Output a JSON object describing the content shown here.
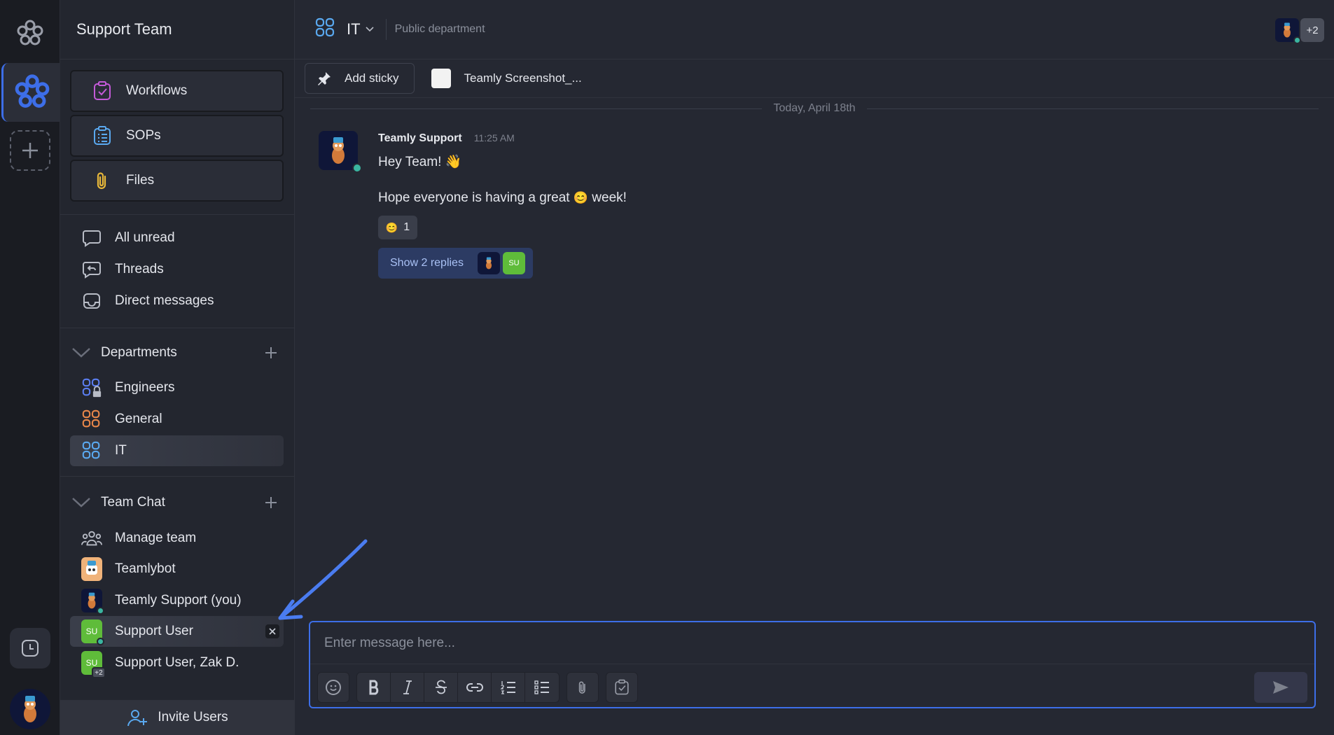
{
  "workspace": {
    "name": "Support Team"
  },
  "sidebar": {
    "primary": [
      {
        "label": "Workflows",
        "icon": "workflows-icon"
      },
      {
        "label": "SOPs",
        "icon": "sops-icon"
      },
      {
        "label": "Files",
        "icon": "files-icon"
      }
    ],
    "nav": [
      {
        "label": "All unread",
        "icon": "chat-bubble-icon"
      },
      {
        "label": "Threads",
        "icon": "threads-icon"
      },
      {
        "label": "Direct messages",
        "icon": "inbox-icon"
      }
    ],
    "departments": {
      "title": "Departments",
      "items": [
        {
          "label": "Engineers",
          "color": "#5b7ef0"
        },
        {
          "label": "General",
          "color": "#e8874a"
        },
        {
          "label": "IT",
          "color": "#5aa9f0"
        }
      ]
    },
    "team_chat": {
      "title": "Team Chat",
      "items": [
        {
          "label": "Manage team"
        },
        {
          "label": "Teamlybot"
        },
        {
          "label": "Teamly Support (you)"
        },
        {
          "label": "Support User",
          "initials": "SU"
        },
        {
          "label": "Support User, Zak D.",
          "initials": "SU",
          "badge": "+2"
        }
      ]
    },
    "invite_label": "Invite Users"
  },
  "channel": {
    "name": "IT",
    "description": "Public department",
    "members_extra": "+2"
  },
  "stickies": {
    "add_label": "Add sticky",
    "file_label": "Teamly Screenshot_..."
  },
  "feed": {
    "date_divider": "Today, April 18th",
    "message": {
      "author": "Teamly Support",
      "time": "11:25 AM",
      "line1": "Hey Team! 👋",
      "line2_a": "Hope everyone is having a great",
      "line2_emoji": "😊",
      "line2_b": "week!",
      "reaction_emoji": "😊",
      "reaction_count": "1",
      "replies_label": "Show 2 replies",
      "reply_initials": "SU"
    }
  },
  "composer": {
    "placeholder": "Enter message here..."
  },
  "colors": {
    "accent": "#3d6ee8",
    "online": "#3ab5a0",
    "su_avatar": "#5fbc3a"
  }
}
